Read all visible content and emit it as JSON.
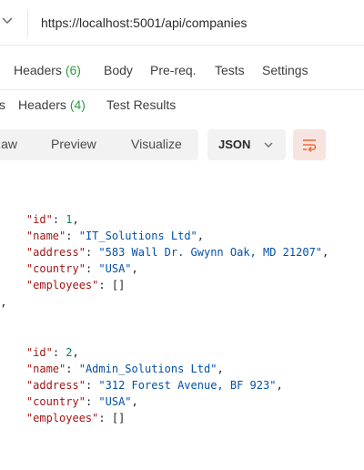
{
  "request": {
    "url": "https://localhost:5001/api/companies",
    "tabs": [
      {
        "label": "Headers",
        "count": "(6)"
      },
      {
        "label": "Body"
      },
      {
        "label": "Pre-req."
      },
      {
        "label": "Tests"
      },
      {
        "label": "Settings"
      }
    ]
  },
  "response": {
    "tabs": [
      {
        "label": "s"
      },
      {
        "label": "Headers",
        "count": "(4)"
      },
      {
        "label": "Test Results"
      }
    ],
    "views": [
      "Raw",
      "Preview",
      "Visualize"
    ],
    "format": "JSON",
    "wrap_icon": "text-wrap-icon",
    "body": {
      "companies": [
        {
          "id_key": "\"id\"",
          "id_val": "1",
          "name_key": "\"name\"",
          "name_val": "\"IT_Solutions Ltd\"",
          "address_key": "\"address\"",
          "address_val": "\"583 Wall Dr. Gwynn Oak, MD 21207\"",
          "country_key": "\"country\"",
          "country_val": "\"USA\"",
          "employees_key": "\"employees\"",
          "employees_val": "[]"
        },
        {
          "id_key": "\"id\"",
          "id_val": "2",
          "name_key": "\"name\"",
          "name_val": "\"Admin_Solutions Ltd\"",
          "address_key": "\"address\"",
          "address_val": "\"312 Forest Avenue, BF 923\"",
          "country_key": "\"country\"",
          "country_val": "\"USA\"",
          "employees_key": "\"employees\"",
          "employees_val": "[]"
        }
      ],
      "separator": "},"
    }
  },
  "colors": {
    "accent": "#f26b3a",
    "count": "#2f9a3f",
    "json_key": "#a31515",
    "json_string": "#0451a5",
    "json_number": "#098658"
  }
}
